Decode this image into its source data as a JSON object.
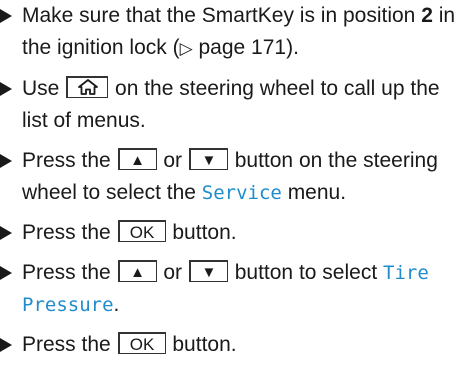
{
  "steps": [
    {
      "s0_before": "Make sure that the SmartKey is in position ",
      "s0_bold": "2",
      "s0_after": " in the ignition lock (",
      "s0_ref_symbol": "▷",
      "s0_ref_page": " page 171)."
    },
    {
      "s1_before": "Use ",
      "s1_key_icon": "home-icon",
      "s1_after": " on the steering wheel to call up the list of menus."
    },
    {
      "s2_before": "Press the ",
      "s2_key_up": "▲",
      "s2_mid": " or ",
      "s2_key_down": "▼",
      "s2_after": " button on the steering wheel to select the ",
      "s2_menu": "Service",
      "s2_end": " menu."
    },
    {
      "s3_before": "Press the ",
      "s3_key": "OK",
      "s3_after": " button."
    },
    {
      "s4_before": "Press the ",
      "s4_key_up": "▲",
      "s4_mid": " or ",
      "s4_key_down": "▼",
      "s4_after": " button to select ",
      "s4_menu": "Tire Pressure",
      "s4_end": "."
    },
    {
      "s5_before": "Press the ",
      "s5_key": "OK",
      "s5_after": " button."
    }
  ],
  "colors": {
    "text": "#1a1a1a",
    "menu_highlight": "#1f8ccc"
  }
}
